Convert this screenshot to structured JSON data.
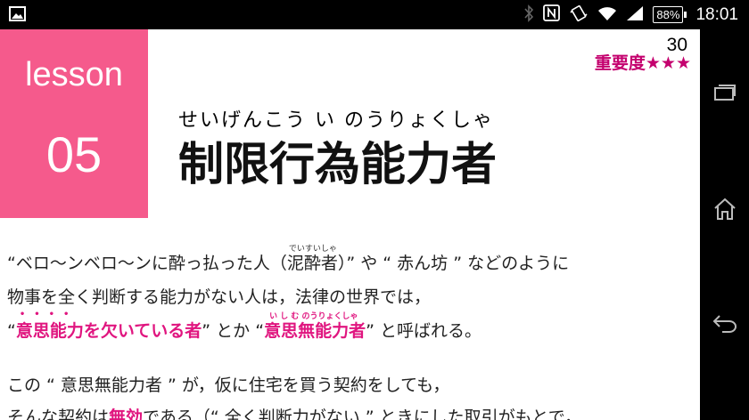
{
  "statusbar": {
    "time": "18:01",
    "battery": "88%",
    "icons": [
      "image-icon",
      "bluetooth-icon",
      "nfc-icon",
      "vibrate-icon",
      "wifi-icon",
      "signal-icon"
    ]
  },
  "header": {
    "lesson_label": "lesson",
    "lesson_number": "05",
    "lesson_color": "#f55a8c",
    "page_number": "30",
    "importance": "重要度★★★",
    "title_ruby": "せいげんこう い のうりょくしゃ",
    "title": "制限行為能力者"
  },
  "body": {
    "line1": {
      "a": "“ベロ〜ンベロ〜ンに酔っ払った人（",
      "b": "泥酔者",
      "c": "）” や “ 赤ん坊 ” などのように",
      "ruby": "でいすいしゃ"
    },
    "line2": "物事を全く判断する能力がない人は，法律の世界では，",
    "line3": {
      "a": "“",
      "b": "意思能力を欠いている者",
      "c": "” とか “",
      "d": "意思無能力者",
      "e": "” と呼ばれる。",
      "ruby": "い し む のうりょくしゃ",
      "dots": "••••"
    },
    "line4": "この “ 意思無能力者 ” が，仮に住宅を買う契約をしても，",
    "line5": {
      "a": "そんな契約は",
      "b": "無効",
      "c": "である（“ 全く判断力がない ” ときにした取引がもとで，"
    },
    "accent_color": "#e0157f"
  },
  "navbar": {
    "buttons": [
      "recents-icon",
      "home-icon",
      "back-icon"
    ]
  }
}
